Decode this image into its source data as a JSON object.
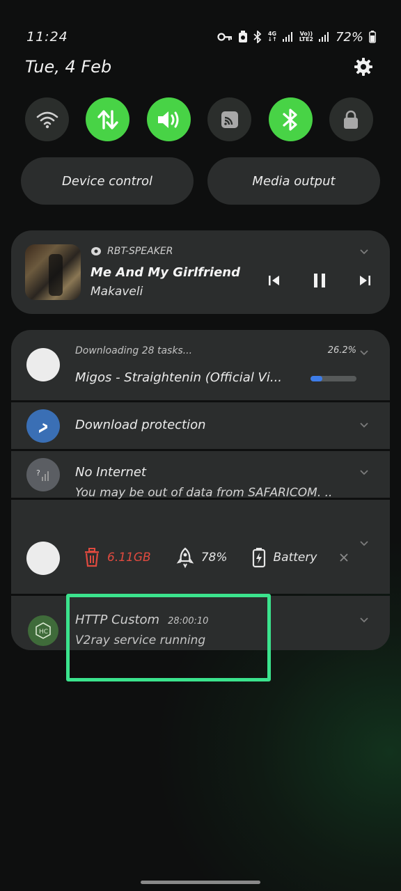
{
  "status_bar": {
    "time": "11:24",
    "network_4g": "4G",
    "volte_line1": "Vo))",
    "volte_line2": "LTE2",
    "battery_percent": "72%"
  },
  "header": {
    "date": "Tue, 4 Feb"
  },
  "quick_toggles": [
    {
      "name": "wifi",
      "icon": "wifi-icon",
      "active": false
    },
    {
      "name": "mobile-data",
      "icon": "data-arrows-icon",
      "active": true
    },
    {
      "name": "sound",
      "icon": "speaker-icon",
      "active": true
    },
    {
      "name": "cast",
      "icon": "cast-icon",
      "active": false
    },
    {
      "name": "bluetooth",
      "icon": "bluetooth-icon",
      "active": true
    },
    {
      "name": "lock",
      "icon": "lock-icon",
      "active": false
    }
  ],
  "pills": {
    "device_control": "Device control",
    "media_output": "Media output"
  },
  "media": {
    "source": "RBT-SPEAKER",
    "title": "Me And My Girlfriend",
    "artist": "Makaveli"
  },
  "notifications": {
    "download": {
      "header": "Downloading 28 tasks...",
      "percent": "26.2%",
      "title": "Migos - Straightenin (Official Vi...",
      "progress": 0.262
    },
    "protection": {
      "title": "Download protection"
    },
    "no_internet": {
      "title": "No Internet",
      "body": "You may be out of data from SAFARICOM. .."
    },
    "widget": {
      "storage": "6.11GB",
      "boost": "78%",
      "battery": "Battery"
    },
    "http_custom": {
      "title": "HTTP Custom",
      "time": "28:00:10",
      "body": "V2ray service running"
    }
  },
  "colors": {
    "accent_green": "#48d346",
    "card_bg": "#2b2d2d",
    "highlight": "#3be38d",
    "trash_red": "#e04a3f",
    "progress_blue": "#3d7ce8"
  }
}
